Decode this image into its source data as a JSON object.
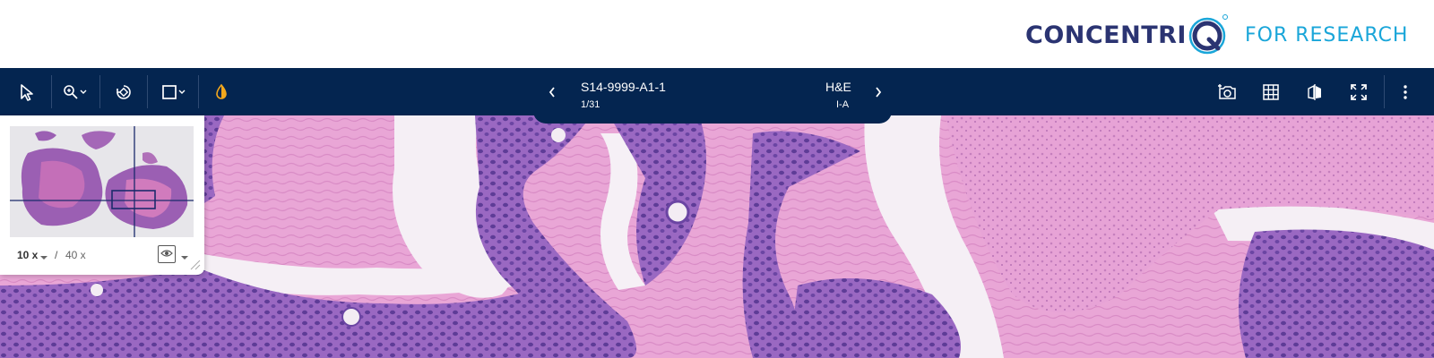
{
  "brand": {
    "name_prefix": "CONCENTRI",
    "sub": "FOR RESEARCH",
    "colors": {
      "navy": "#2b3472",
      "cyan": "#1aa6d9"
    }
  },
  "toolbar": {
    "background": "#042550",
    "tools": [
      {
        "icon": "cursor-icon"
      },
      {
        "icon": "zoom-icon"
      },
      {
        "icon": "rotate-icon"
      },
      {
        "icon": "rectangle-icon"
      },
      {
        "icon": "color-adjust-icon"
      }
    ],
    "right_tools": [
      {
        "icon": "snapshot-icon"
      },
      {
        "icon": "grid-icon"
      },
      {
        "icon": "compare-icon"
      },
      {
        "icon": "fullscreen-icon"
      },
      {
        "icon": "more-vertical-icon"
      }
    ]
  },
  "slide": {
    "name": "S14-9999-A1-1",
    "counter": "1/31",
    "stain": "H&E",
    "block": "I-A"
  },
  "overview": {
    "zoom_current": "10 x",
    "zoom_separator": "/",
    "zoom_max": "40 x"
  }
}
